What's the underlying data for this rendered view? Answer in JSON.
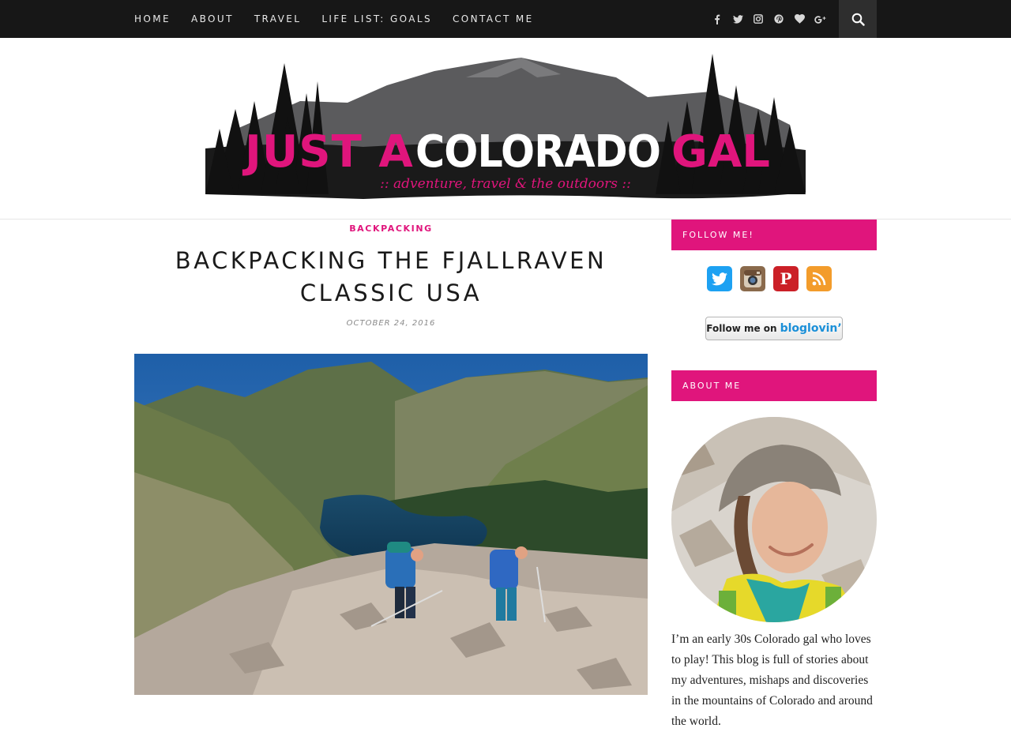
{
  "nav": {
    "items": [
      {
        "label": "HOME"
      },
      {
        "label": "ABOUT"
      },
      {
        "label": "TRAVEL"
      },
      {
        "label": "LIFE LIST: GOALS"
      },
      {
        "label": "CONTACT ME"
      }
    ],
    "social_icons": [
      "facebook-icon",
      "twitter-icon",
      "instagram-icon",
      "pinterest-icon",
      "heart-icon",
      "google-plus-icon"
    ],
    "search_icon": "search-icon"
  },
  "header": {
    "logo_text_pink": "JUST A",
    "logo_text_white_1": "COLORADO",
    "logo_text_pink_2": "GAL",
    "tagline": ":: adventure, travel & the outdoors ::"
  },
  "post": {
    "category": "BACKPACKING",
    "title": "BACKPACKING THE FJALLRAVEN CLASSIC USA",
    "date": "OCTOBER 24, 2016"
  },
  "sidebar": {
    "follow_title": "FOLLOW ME!",
    "follow_icons": [
      "twitter-icon",
      "instagram-icon",
      "pinterest-icon",
      "rss-icon"
    ],
    "bloglovin_prefix": "Follow me on",
    "bloglovin_brand": "bloglovin’",
    "about_title": "ABOUT ME",
    "about_text": "I’m an early 30s Colorado gal who loves to play! This blog is full of stories about my adventures, mishaps and discoveries in the mountains of Colorado and around the world."
  },
  "colors": {
    "accent": "#e0157c",
    "topbar": "#171717"
  }
}
